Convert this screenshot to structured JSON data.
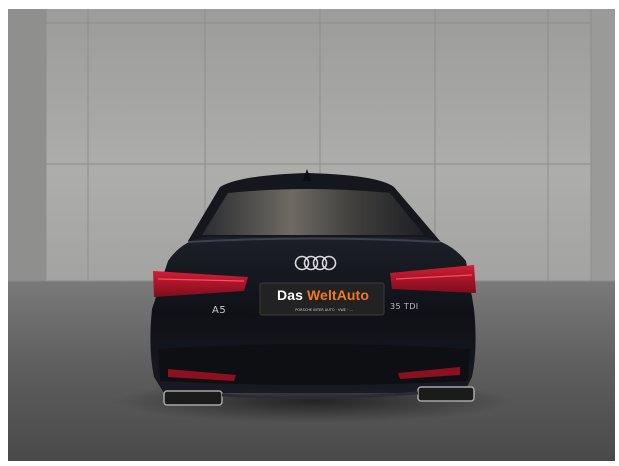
{
  "photo": {
    "subject": "car-rear",
    "colors": {
      "wall": "#a9a9a7",
      "floor": "#5d5d5d",
      "body": "#12141a",
      "taillight": "#b3142a",
      "plate_bg": "#202020",
      "brand_orange": "#f07a23"
    }
  },
  "car": {
    "model_badge": "A5",
    "trim_badge": "35 TDI",
    "logo": "audi-four-rings"
  },
  "plate": {
    "brand_part1": "Das ",
    "brand_part2": "WeltAuto",
    "dealer_line": "PORSCHE INTER AUTO · VWE · ..."
  }
}
